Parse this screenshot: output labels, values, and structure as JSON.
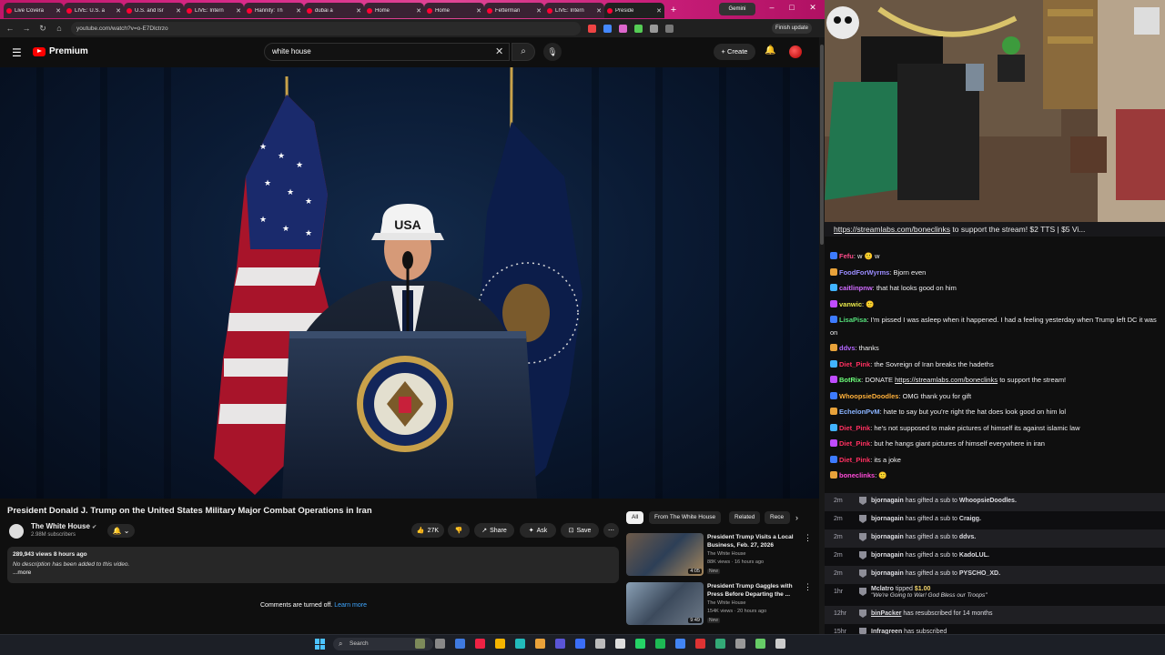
{
  "browser": {
    "tabs": [
      {
        "label": "Live Covera",
        "active": false
      },
      {
        "label": "LIVE: U.S. a",
        "active": false
      },
      {
        "label": "U.S. and Isr",
        "active": false
      },
      {
        "label": "LIVE: Intern",
        "active": false
      },
      {
        "label": "Hannity: Th",
        "active": false
      },
      {
        "label": "dubai a",
        "active": false
      },
      {
        "label": "Home",
        "active": false
      },
      {
        "label": "Home",
        "active": false
      },
      {
        "label": "Fetterman",
        "active": false
      },
      {
        "label": "LIVE: Intern",
        "active": false
      },
      {
        "label": "Preside",
        "active": true
      }
    ],
    "new_tab": "+",
    "gemini_label": "Gemini",
    "url": "youtube.com/watch?v=o-E7Dlctrzo",
    "finish_update": "Finish update",
    "window_controls": [
      "–",
      "□",
      "✕"
    ]
  },
  "youtube": {
    "logo_text": "Premium",
    "search_value": "white house",
    "create_label": "Create",
    "video_title": "President Donald J. Trump on the United States Military Major Combat Operations in Iran",
    "channel_name": "The White House",
    "channel_subs": "2.98M subscribers",
    "likes": "27K",
    "share_label": "Share",
    "ask_label": "Ask",
    "save_label": "Save",
    "description": {
      "meta": "289,943 views  8 hours ago",
      "text": "No description has been added to this video.",
      "more": "...more"
    },
    "comments_off": "Comments are turned off.",
    "learn_more": "Learn more",
    "chips": [
      "All",
      "From The White House",
      "Related",
      "Rece"
    ],
    "related": [
      {
        "title": "President Trump Visits a Local Business, Feb. 27, 2026",
        "channel": "The White House",
        "views": "88K views · 16 hours ago",
        "badge": "New",
        "duration": "4:05"
      },
      {
        "title": "President Trump Gaggles with Press Before Departing the ...",
        "channel": "The White House",
        "views": "154K views · 20 hours ago",
        "badge": "New",
        "duration": "9:49"
      }
    ]
  },
  "stream_chat": {
    "banner_link": "https://streamlabs.com/boneclinks",
    "banner_rest": " to support the stream! $2 TTS | $5 Vi...",
    "messages": [
      {
        "name": "Fefu",
        "color": "#ff4b8a",
        "text": "w 🙂 w"
      },
      {
        "name": "FoodForWyrms",
        "color": "#9b8cff",
        "text": "Bjorn even"
      },
      {
        "name": "caitlinpnw",
        "color": "#d06bff",
        "text": "that hat looks good on him"
      },
      {
        "name": "vanwic",
        "color": "#e8e84a",
        "text": "🙂"
      },
      {
        "name": "LisaPisa",
        "color": "#55e07a",
        "text": "I'm pissed I was asleep when it happened. I had a feeling yesterday when Trump left DC it was on"
      },
      {
        "name": "ddvs",
        "color": "#b366ff",
        "text": "thanks"
      },
      {
        "name": "Diet_Pink",
        "color": "#ff3060",
        "text": "the Sovreign of Iran breaks the hadeths"
      },
      {
        "name": "BotRix",
        "color": "#6cff7a",
        "text": "DONATE",
        "link": "https://streamlabs.com/boneclinks",
        "after": "to support the stream!"
      },
      {
        "name": "WhoopsieDoodles",
        "color": "#ffb03a",
        "text": "OMG thank you for gift"
      },
      {
        "name": "EchelonPvM",
        "color": "#8ab4ff",
        "text": "hate to say but you're right the hat does look good on him lol"
      },
      {
        "name": "Diet_Pink",
        "color": "#ff3060",
        "text": "he's not supposed to make pictures of himself its against islamic law"
      },
      {
        "name": "Diet_Pink",
        "color": "#ff3060",
        "text": "but he hangs giant pictures of himself everywhere in iran"
      },
      {
        "name": "Diet_Pink",
        "color": "#ff3060",
        "text": "its a joke"
      },
      {
        "name": "boneclinks",
        "color": "#ff4bd8",
        "text": "🙂"
      }
    ],
    "alerts": [
      {
        "time": "2m",
        "name": "bjornagain",
        "text": "has gifted a sub to",
        "target": "WhoopsieDoodles."
      },
      {
        "time": "2m",
        "name": "bjornagain",
        "text": "has gifted a sub to",
        "target": "Craigg."
      },
      {
        "time": "2m",
        "name": "bjornagain",
        "text": "has gifted a sub to",
        "target": "ddvs."
      },
      {
        "time": "2m",
        "name": "bjornagain",
        "text": "has gifted a sub to",
        "target": "KadoLUL."
      },
      {
        "time": "2m",
        "name": "bjornagain",
        "text": "has gifted a sub to",
        "target": "PYSCHO_XD."
      },
      {
        "time": "1hr",
        "name": "Mclatro",
        "text": "tipped",
        "target": "$1.00",
        "note": "\"We're Going to War! God Bless our Troops\""
      },
      {
        "time": "12hr",
        "name": "binPacker",
        "text": "has resubscribed for 14 months",
        "target": ""
      },
      {
        "time": "15hr",
        "name": "Infragreen",
        "text": "has subscribed",
        "target": ""
      }
    ]
  },
  "taskbar": {
    "search_placeholder": "Search"
  },
  "colors": {
    "yt_red": "#ff0000",
    "link_blue": "#3ea6ff",
    "chat_bg": "#18181b"
  }
}
